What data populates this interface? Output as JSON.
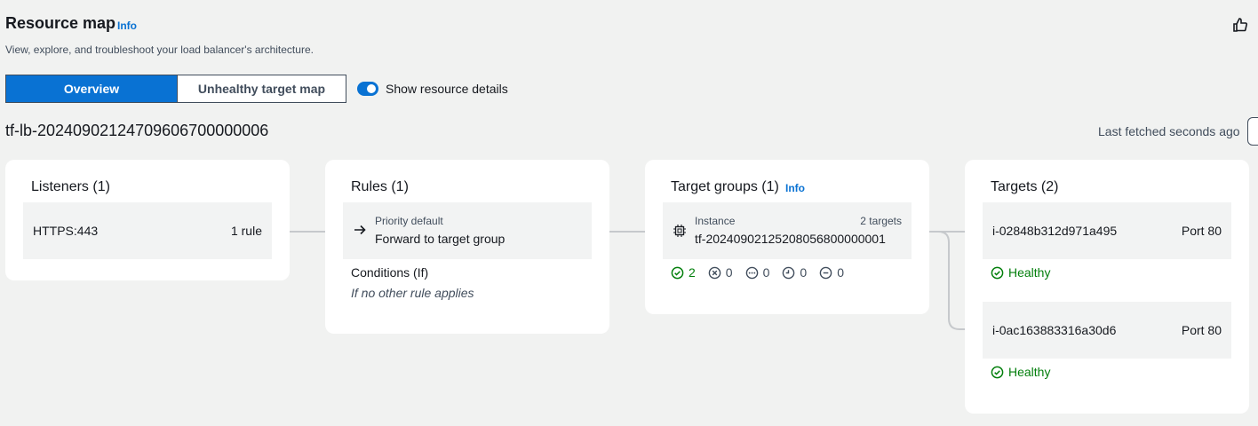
{
  "header": {
    "title": "Resource map",
    "info": "Info",
    "subtitle": "View, explore, and troubleshoot your load balancer's architecture."
  },
  "tabs": {
    "overview": "Overview",
    "unhealthy": "Unhealthy target map"
  },
  "toggle": {
    "label": "Show resource details",
    "on": true
  },
  "lb_name": "tf-lb-20240902124709606700000006",
  "last_fetched": "Last fetched seconds ago",
  "listeners": {
    "title": "Listeners (1)",
    "item": {
      "protocol": "HTTPS:443",
      "rules": "1 rule"
    }
  },
  "rules": {
    "title": "Rules (1)",
    "item": {
      "priority": "Priority default",
      "action": "Forward to target group"
    },
    "conditions_label": "Conditions (If)",
    "conditions_value": "If no other rule applies"
  },
  "target_groups": {
    "title": "Target groups (1)",
    "info": "Info",
    "item": {
      "type": "Instance",
      "count": "2 targets",
      "name": "tf-20240902125208056800000001"
    },
    "stats": {
      "healthy": "2",
      "unhealthy": "0",
      "unused": "0",
      "draining": "0",
      "unavailable": "0"
    }
  },
  "targets": {
    "title": "Targets (2)",
    "items": [
      {
        "id": "i-02848b312d971a495",
        "port": "Port 80",
        "status": "Healthy"
      },
      {
        "id": "i-0ac163883316a30d6",
        "port": "Port 80",
        "status": "Healthy"
      }
    ]
  },
  "colors": {
    "accent": "#0972d3",
    "healthy": "#037f0c",
    "background": "#f1f2f1"
  }
}
